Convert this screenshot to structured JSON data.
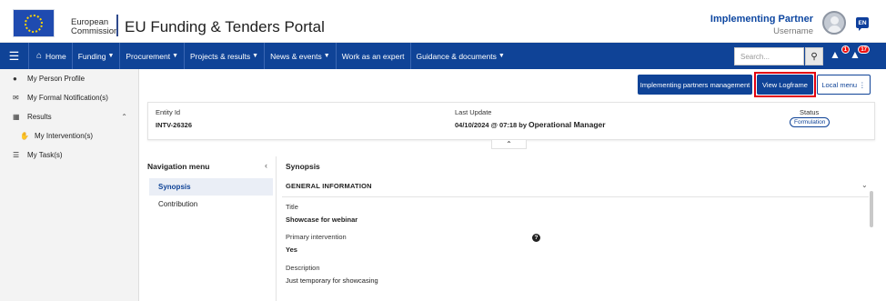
{
  "header": {
    "org_line1": "European",
    "org_line2": "Commission",
    "portal_title": "EU Funding & Tenders Portal",
    "user_role": "Implementing Partner",
    "user_name": "Username",
    "language": "EN"
  },
  "navbar": {
    "home": "Home",
    "items": [
      {
        "label": "Funding",
        "caret": true
      },
      {
        "label": "Procurement",
        "caret": true
      },
      {
        "label": "Projects & results",
        "caret": true
      },
      {
        "label": "News & events",
        "caret": true
      },
      {
        "label": "Work as an expert",
        "caret": false
      },
      {
        "label": "Guidance & documents",
        "caret": true
      }
    ],
    "search_placeholder": "Search...",
    "notif1_count": "1",
    "notif2_count": "17"
  },
  "sidebar": {
    "items": [
      {
        "label": "My Person Profile",
        "icon": "user-icon"
      },
      {
        "label": "My Formal Notification(s)",
        "icon": "envelope-icon"
      },
      {
        "label": "Results",
        "icon": "grid-icon"
      },
      {
        "label": "My Intervention(s)",
        "icon": "hand-icon"
      },
      {
        "label": "My Task(s)",
        "icon": "list-icon"
      }
    ]
  },
  "actions": {
    "implementing_partners_management": "Implementing partners management",
    "view_logframe": "View Logframe",
    "local_menu": "Local menu ⋮"
  },
  "entity": {
    "id_label": "Entity Id",
    "id_value": "INTV-26326",
    "last_update_label": "Last Update",
    "last_update_value": "04/10/2024 @ 07:18 by",
    "last_update_by": "Operational Manager",
    "status_label": "Status",
    "status_value": "Formulation"
  },
  "navigation_menu": {
    "title": "Navigation menu",
    "items": [
      "Synopsis",
      "Contribution"
    ],
    "active": "Synopsis"
  },
  "synopsis": {
    "title": "Synopsis",
    "section": "GENERAL INFORMATION",
    "fields": [
      {
        "label": "Title",
        "value": "Showcase for webinar"
      },
      {
        "label": "Primary intervention",
        "value": "Yes"
      },
      {
        "label": "Description",
        "value": "Just temporary for showcasing"
      }
    ]
  },
  "colors": {
    "brand_blue": "#0f4397",
    "highlight_red": "#e2000f",
    "notification_red": "#e11111"
  }
}
